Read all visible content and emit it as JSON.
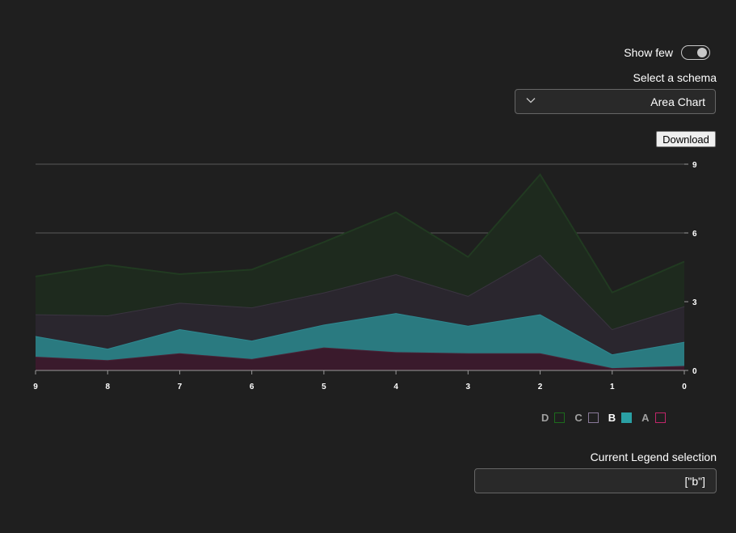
{
  "controls": {
    "toggle_label": "Show few",
    "schema_label": "Select a schema",
    "schema_value": "Area Chart",
    "download_label": "Download",
    "legend_selection_label": "Current Legend selection",
    "legend_selection_value": "[\"b\"]"
  },
  "legend": [
    {
      "name": "D",
      "color": "#1c6b1c",
      "fill": "transparent"
    },
    {
      "name": "C",
      "color": "#8a7a9a",
      "fill": "transparent"
    },
    {
      "name": "B",
      "color": "#2aa0a4",
      "fill": "#2aa0a4",
      "selected": true
    },
    {
      "name": "A",
      "color": "#c0266a",
      "fill": "transparent"
    }
  ],
  "chart_data": {
    "type": "area",
    "stacked": true,
    "x": [
      9,
      8,
      7,
      6,
      5,
      4,
      3,
      2,
      1,
      0
    ],
    "ylim": [
      0,
      9
    ],
    "yticks": [
      0,
      3,
      6,
      9
    ],
    "y_axis_side": "right",
    "grid": true,
    "series": [
      {
        "name": "A",
        "color": "#3a1a2c",
        "edge": "#4a2236",
        "values": [
          0.6,
          0.45,
          0.75,
          0.5,
          1.0,
          0.8,
          0.75,
          0.75,
          0.1,
          0.2
        ]
      },
      {
        "name": "B",
        "color": "#2a7a80",
        "edge": "#2e8890",
        "values": [
          0.9,
          0.5,
          1.05,
          0.8,
          1.0,
          1.7,
          1.2,
          1.7,
          0.6,
          1.05
        ]
      },
      {
        "name": "C",
        "color": "#2a262e",
        "edge": "#3a3440",
        "values": [
          0.95,
          1.45,
          1.15,
          1.45,
          1.4,
          1.7,
          1.3,
          2.6,
          1.1,
          1.55
        ]
      },
      {
        "name": "D",
        "color": "#1e2a1e",
        "edge": "#213a21",
        "values": [
          1.65,
          2.2,
          1.25,
          1.65,
          2.2,
          2.7,
          1.7,
          3.5,
          1.6,
          1.95
        ]
      }
    ]
  }
}
